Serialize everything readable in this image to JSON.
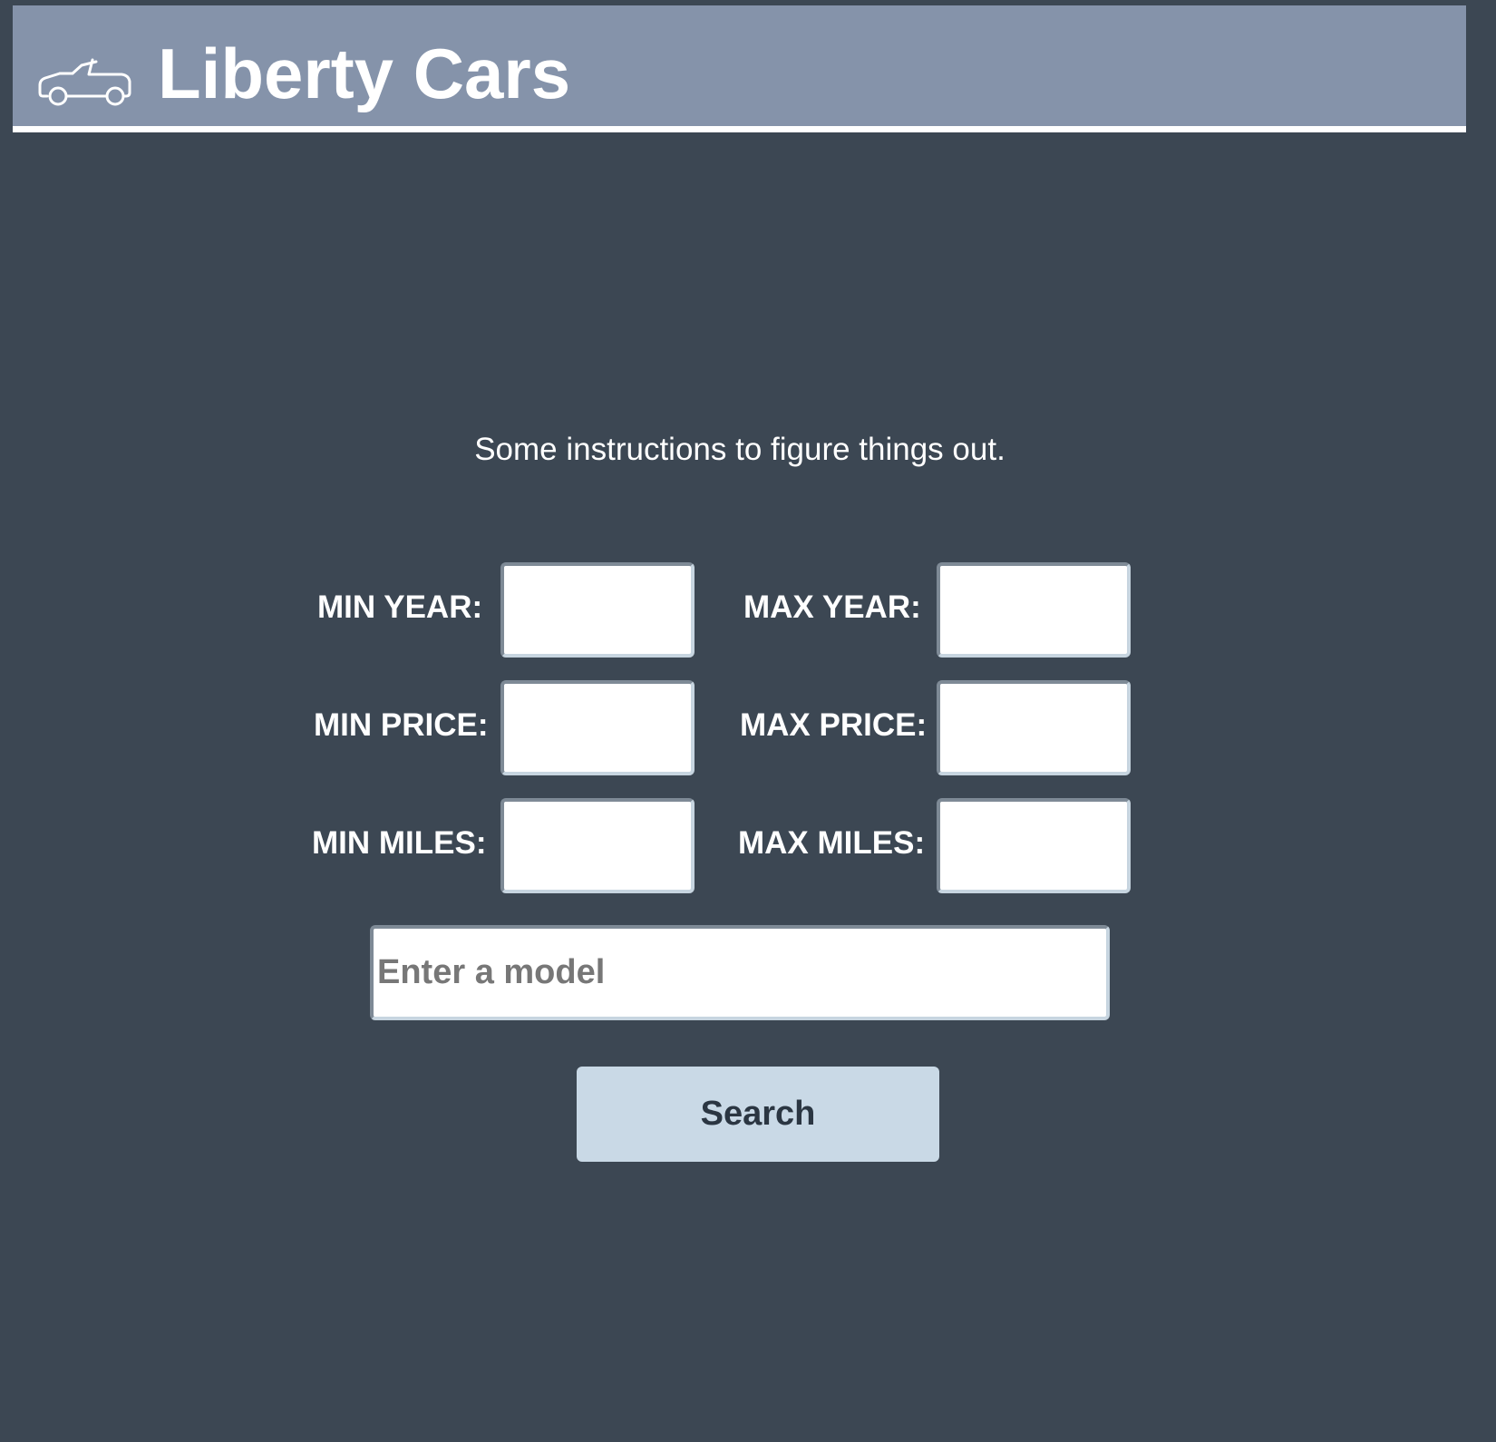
{
  "header": {
    "title": "Liberty Cars",
    "logo_icon": "car-icon"
  },
  "instructions": "Some instructions to figure things out.",
  "filters": {
    "min_year": {
      "label": "MIN YEAR:",
      "value": ""
    },
    "max_year": {
      "label": "MAX YEAR:",
      "value": ""
    },
    "min_price": {
      "label": "MIN PRICE:",
      "value": ""
    },
    "max_price": {
      "label": "MAX PRICE:",
      "value": ""
    },
    "min_miles": {
      "label": "MIN MILES:",
      "value": ""
    },
    "max_miles": {
      "label": "MAX MILES:",
      "value": ""
    }
  },
  "model": {
    "placeholder": "Enter a model",
    "value": ""
  },
  "search_button": {
    "label": "Search"
  },
  "colors": {
    "background": "#3c4753",
    "header": "#8593aa",
    "button": "#c9d9e6",
    "text": "#ffffff"
  }
}
